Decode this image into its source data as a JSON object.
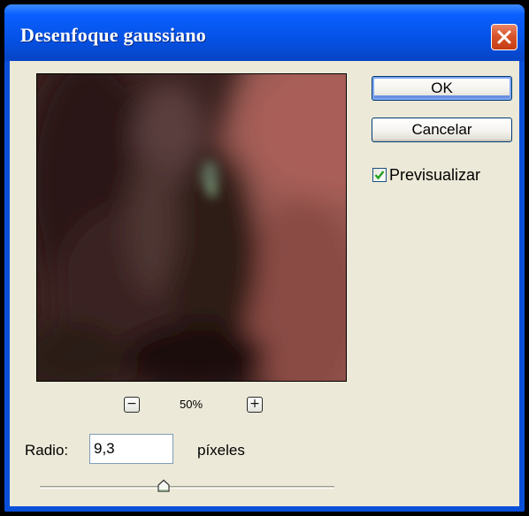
{
  "window": {
    "title": "Desenfoque gaussiano"
  },
  "buttons": {
    "ok_label": "OK",
    "cancel_label": "Cancelar"
  },
  "preview_checkbox": {
    "label": "Previsualizar",
    "checked": true
  },
  "zoom": {
    "level": "50%",
    "minus_symbol": "−",
    "plus_symbol": "+"
  },
  "radius": {
    "label": "Radio:",
    "value": "9,3",
    "unit": "píxeles",
    "slider_fraction": 0.42
  },
  "colors": {
    "title_bar": "#0552e6",
    "dialog_background": "#ece9d8",
    "close_button": "#d9542c",
    "checkmark": "#21a121",
    "selection": "#316ac5"
  },
  "icons": {
    "close": "close-icon",
    "checkmark": "checkmark-icon",
    "zoom_out": "zoom-out-icon",
    "zoom_in": "zoom-in-icon"
  }
}
